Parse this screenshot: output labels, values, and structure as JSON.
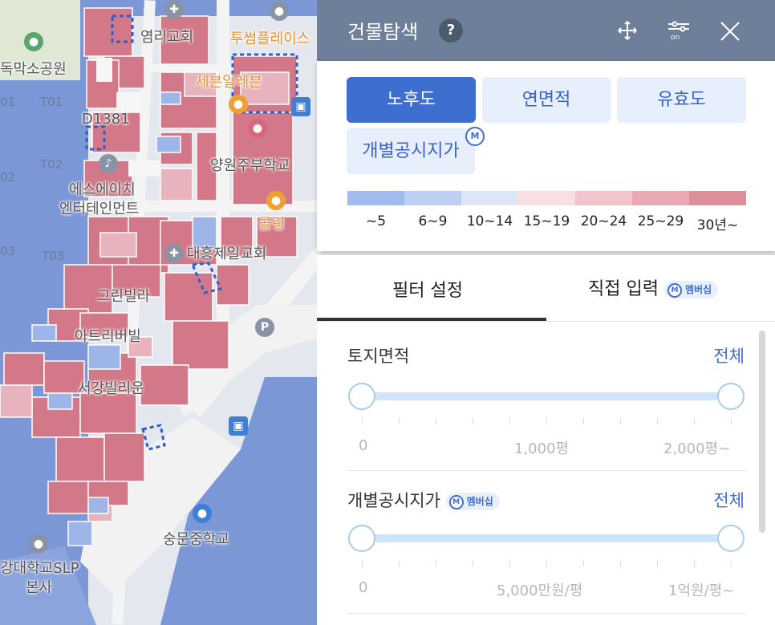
{
  "map": {
    "labels": {
      "church1": "염리교회",
      "twosome": "투썸플레이스",
      "park": "독막소공원",
      "seven": "세븐일레븐",
      "d1381": "D1381",
      "school1": "양원주부학교",
      "sh_ent1": "에스에이치",
      "sh_ent2": "엔터테인먼트",
      "coring": "콜링",
      "church2": "대흥제일교회",
      "green": "그린빌라",
      "atre": "아트리버빌",
      "sgvillage": "서강빌리운",
      "middle": "숭문중학교",
      "slp1": "강대학교SLP",
      "slp2": "본사",
      "t01a": "01",
      "t01b": "T01",
      "t02a": "02",
      "t02b": "T02",
      "t03a": "03",
      "t03b": "T03"
    }
  },
  "panel": {
    "title": "건물탐색",
    "help": "?",
    "buttons": {
      "move": "move-icon",
      "settings": "settings-on-icon",
      "close": "×"
    },
    "modes": [
      "노후도",
      "연면적",
      "유효도",
      "개별공시지가"
    ],
    "membership_mark": "M",
    "legend": {
      "colors": [
        "#9fbcec",
        "#bdd0f3",
        "#dde6f8",
        "#f8dfe3",
        "#f2c5cd",
        "#eaaab4",
        "#df8e9b"
      ],
      "labels": [
        "~5",
        "6~9",
        "10~14",
        "15~19",
        "20~24",
        "25~29",
        "30년~"
      ]
    },
    "tabs": {
      "filter": "필터 설정",
      "direct": "직접 입력",
      "membership": "멤버십"
    },
    "filters": [
      {
        "label": "토지면적",
        "all": "전체",
        "range": [
          0,
          1
        ],
        "scale": [
          "0",
          "1,000평",
          "2,000평~"
        ]
      },
      {
        "label": "개별공시지가",
        "membership": "멤버십",
        "all": "전체",
        "range": [
          0,
          1
        ],
        "scale": [
          "0",
          "5,000만원/평",
          "1억원/평~"
        ]
      }
    ]
  }
}
